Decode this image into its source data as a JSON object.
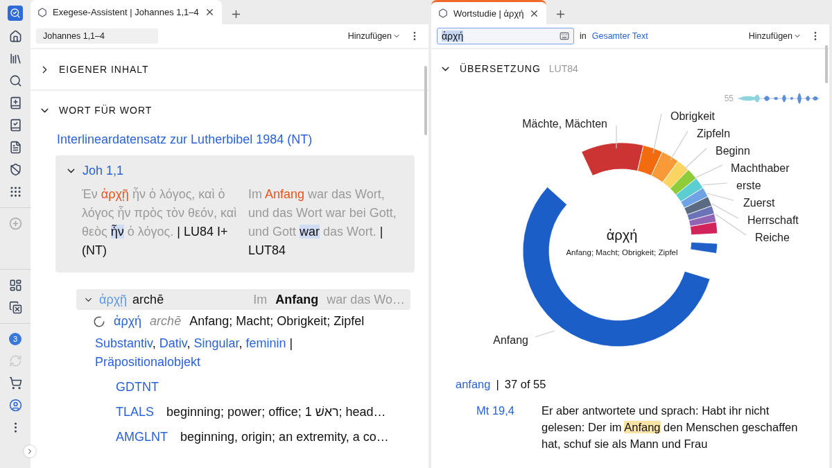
{
  "sidebar": {
    "notification_count": "3"
  },
  "left_panel": {
    "tabs": [
      {
        "title": "Exegese-Assistent | Johannes 1,1–4",
        "selected": true,
        "focused": false
      }
    ],
    "reference": "Johannes 1,1–4",
    "add_menu": "Hinzufügen",
    "sections": [
      {
        "title": "EIGENER INHALT",
        "expanded": false
      },
      {
        "title": "WORT FÜR WORT",
        "expanded": true
      }
    ],
    "dataset_link": "Interlineardatensatz zur Lutherbibel 1984 (NT)",
    "verse": {
      "reference": "Joh 1,1",
      "expanded": true,
      "greek": [
        {
          "text": "Ἐν ",
          "kind": "plain"
        },
        {
          "text": "ἀρχῇ",
          "kind": "match"
        },
        {
          "text": " ἦν ὁ λόγος, καὶ ὁ λόγος ἦν πρὸς τὸν θεόν, καὶ θεὸς ",
          "kind": "plain"
        },
        {
          "text": "ἦν",
          "kind": "current"
        },
        {
          "text": " ὁ λόγος. ",
          "kind": "plain"
        }
      ],
      "greek_source": "| LU84 I+ (NT)",
      "german": [
        {
          "text": "Im ",
          "kind": "plain"
        },
        {
          "text": "Anfang",
          "kind": "match"
        },
        {
          "text": " war das Wort, und das Wort war bei Gott, und Gott ",
          "kind": "plain"
        },
        {
          "text": "war",
          "kind": "current"
        },
        {
          "text": " das Wort. ",
          "kind": "plain"
        }
      ],
      "german_source": "| LUT84"
    },
    "word_row": {
      "greek": "ἀρχῇ",
      "translit": "archē",
      "expanded": true,
      "context": [
        {
          "text": "Im",
          "kind": "plain"
        },
        {
          "text": "Anfang",
          "kind": "match"
        },
        {
          "text": "war das Wo…",
          "kind": "plain"
        }
      ]
    },
    "lemma": {
      "greek": "ἀρχή",
      "translit": "archē",
      "glosses": "Anfang; Macht; Obrigkeit; Zipfel"
    },
    "morphology": {
      "items": [
        "Substantiv",
        "Dativ",
        "Singular",
        "feminin"
      ],
      "separator": ",",
      "role_separator": "|",
      "role": "Präpositionalobjekt"
    },
    "lexicons": [
      {
        "abbr": "GDTNT"
      },
      {
        "abbr": "TLALS",
        "definition": "beginning; power; office; 1 ראשׁ; head…"
      },
      {
        "abbr": "AMGLNT",
        "definition": "beginning, origin; an extremity, a co…"
      }
    ]
  },
  "right_panel": {
    "tabs": [
      {
        "title": "Wortstudie | ἀρχή",
        "selected": true,
        "focused": true
      }
    ],
    "search": {
      "value": "ἀρχή",
      "in_label": "in",
      "scope": "Gesamter Text"
    },
    "add_menu": "Hinzufügen",
    "section": {
      "title": "ÜBERSETZUNG",
      "subtitle": "LUT84",
      "expanded": true
    },
    "sparkline_count": "55",
    "donut": {
      "center_word": "ἀρχή",
      "center_glosses": "Anfang; Macht; Obrigkeit; Zipfel",
      "slices": [
        {
          "label": "Mächte, Mächten",
          "color": "#cc3333"
        },
        {
          "label": "Obrigkeit",
          "color": "#f26b0f"
        },
        {
          "label": "Zipfeln",
          "color": "#f99a38"
        },
        {
          "label": "Beginn",
          "color": "#fcd462"
        },
        {
          "label": "Machthaber",
          "color": "#8ecc3a"
        },
        {
          "label": "erste",
          "color": "#5ccdd0"
        },
        {
          "label": "Zuerst",
          "color": "#6fa3e6"
        },
        {
          "label": "Herrschaft",
          "color": "#5b6b82"
        },
        {
          "color": "#6a73b5"
        },
        {
          "label": "Reiche",
          "color": "#9065b3"
        },
        {
          "color": "#d2245a"
        },
        {
          "color": "#1f5fc7"
        },
        {
          "label": "Anfang",
          "color": "#1b5ec7"
        }
      ]
    },
    "result": {
      "term": "anfang",
      "separator": "|",
      "count": "37 of 55"
    },
    "verses": [
      {
        "reference": "Mt 19,4",
        "text": [
          {
            "text": "Er aber antwortete und sprach: Habt ihr nicht gelesen: Der im ",
            "kind": "plain"
          },
          {
            "text": "Anfang",
            "kind": "match"
          },
          {
            "text": " den Menschen geschaffen hat, schuf sie als Mann und Frau",
            "kind": "plain"
          }
        ]
      }
    ]
  }
}
